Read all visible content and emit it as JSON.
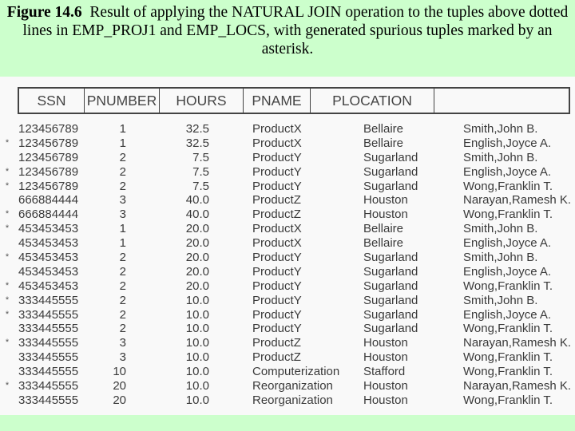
{
  "caption": {
    "figure_label": "Figure 14.6",
    "text": "Result of applying the NATURAL JOIN operation to the tuples above dotted lines in EMP_PROJ1 and EMP_LOCS, with generated spurious tuples marked by an asterisk."
  },
  "table": {
    "columns": [
      "SSN",
      "PNUMBER",
      "HOURS",
      "PNAME",
      "PLOCATION",
      ""
    ],
    "spurious_marker": "*",
    "rows": [
      {
        "spurious": false,
        "ssn": "123456789",
        "pnumber": "1",
        "hours": "32.5",
        "pname": "ProductX",
        "plocation": "Bellaire",
        "ename": "Smith,John B."
      },
      {
        "spurious": true,
        "ssn": "123456789",
        "pnumber": "1",
        "hours": "32.5",
        "pname": "ProductX",
        "plocation": "Bellaire",
        "ename": "English,Joyce A."
      },
      {
        "spurious": false,
        "ssn": "123456789",
        "pnumber": "2",
        "hours": "7.5",
        "pname": "ProductY",
        "plocation": "Sugarland",
        "ename": "Smith,John B."
      },
      {
        "spurious": true,
        "ssn": "123456789",
        "pnumber": "2",
        "hours": "7.5",
        "pname": "ProductY",
        "plocation": "Sugarland",
        "ename": "English,Joyce A."
      },
      {
        "spurious": true,
        "ssn": "123456789",
        "pnumber": "2",
        "hours": "7.5",
        "pname": "ProductY",
        "plocation": "Sugarland",
        "ename": "Wong,Franklin T."
      },
      {
        "spurious": false,
        "ssn": "666884444",
        "pnumber": "3",
        "hours": "40.0",
        "pname": "ProductZ",
        "plocation": "Houston",
        "ename": "Narayan,Ramesh K."
      },
      {
        "spurious": true,
        "ssn": "666884444",
        "pnumber": "3",
        "hours": "40.0",
        "pname": "ProductZ",
        "plocation": "Houston",
        "ename": "Wong,Franklin T."
      },
      {
        "spurious": true,
        "ssn": "453453453",
        "pnumber": "1",
        "hours": "20.0",
        "pname": "ProductX",
        "plocation": "Bellaire",
        "ename": "Smith,John B."
      },
      {
        "spurious": false,
        "ssn": "453453453",
        "pnumber": "1",
        "hours": "20.0",
        "pname": "ProductX",
        "plocation": "Bellaire",
        "ename": "English,Joyce A."
      },
      {
        "spurious": true,
        "ssn": "453453453",
        "pnumber": "2",
        "hours": "20.0",
        "pname": "ProductY",
        "plocation": "Sugarland",
        "ename": "Smith,John B."
      },
      {
        "spurious": false,
        "ssn": "453453453",
        "pnumber": "2",
        "hours": "20.0",
        "pname": "ProductY",
        "plocation": "Sugarland",
        "ename": "English,Joyce A."
      },
      {
        "spurious": true,
        "ssn": "453453453",
        "pnumber": "2",
        "hours": "20.0",
        "pname": "ProductY",
        "plocation": "Sugarland",
        "ename": "Wong,Franklin T."
      },
      {
        "spurious": true,
        "ssn": "333445555",
        "pnumber": "2",
        "hours": "10.0",
        "pname": "ProductY",
        "plocation": "Sugarland",
        "ename": "Smith,John B."
      },
      {
        "spurious": true,
        "ssn": "333445555",
        "pnumber": "2",
        "hours": "10.0",
        "pname": "ProductY",
        "plocation": "Sugarland",
        "ename": "English,Joyce A."
      },
      {
        "spurious": false,
        "ssn": "333445555",
        "pnumber": "2",
        "hours": "10.0",
        "pname": "ProductY",
        "plocation": "Sugarland",
        "ename": "Wong,Franklin T."
      },
      {
        "spurious": true,
        "ssn": "333445555",
        "pnumber": "3",
        "hours": "10.0",
        "pname": "ProductZ",
        "plocation": "Houston",
        "ename": "Narayan,Ramesh K."
      },
      {
        "spurious": false,
        "ssn": "333445555",
        "pnumber": "3",
        "hours": "10.0",
        "pname": "ProductZ",
        "plocation": "Houston",
        "ename": "Wong,Franklin T."
      },
      {
        "spurious": false,
        "ssn": "333445555",
        "pnumber": "10",
        "hours": "10.0",
        "pname": "Computerization",
        "plocation": "Stafford",
        "ename": "Wong,Franklin T."
      },
      {
        "spurious": true,
        "ssn": "333445555",
        "pnumber": "20",
        "hours": "10.0",
        "pname": "Reorganization",
        "plocation": "Houston",
        "ename": "Narayan,Ramesh K."
      },
      {
        "spurious": false,
        "ssn": "333445555",
        "pnumber": "20",
        "hours": "10.0",
        "pname": "Reorganization",
        "plocation": "Houston",
        "ename": "Wong,Franklin T."
      }
    ]
  },
  "colors": {
    "page_background": "#ccffcc",
    "panel_background": "#f9f9f9",
    "text": "#3a3a3a",
    "border": "#444444"
  }
}
